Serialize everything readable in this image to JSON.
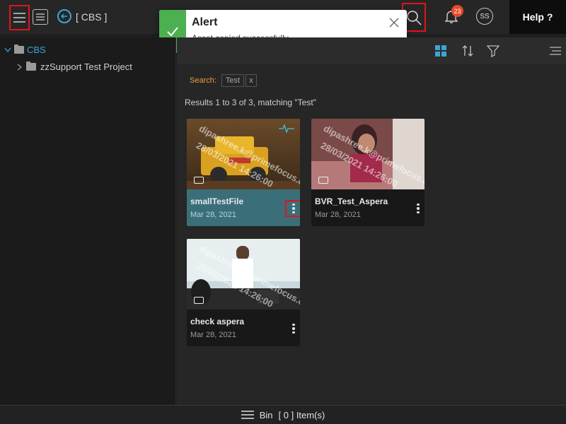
{
  "header": {
    "breadcrumb": "[ CBS ]",
    "notification_count": "23",
    "avatar_initials": "SS",
    "help_label": "Help ?"
  },
  "sidebar": {
    "root_label": "CBS",
    "child_label": "zzSupport Test Project"
  },
  "search": {
    "label": "Search:",
    "term": "Test",
    "clear": "x"
  },
  "results_text": "Results 1 to 3 of 3, matching \"Test\"",
  "assets": [
    {
      "title": "smallTestFile",
      "date": "Mar 28, 2021",
      "selected": true
    },
    {
      "title": "BVR_Test_Aspera",
      "date": "Mar 28, 2021",
      "selected": false
    },
    {
      "title": "check aspera",
      "date": "Mar 28, 2021",
      "selected": false
    }
  ],
  "watermark": {
    "line1": "dipashree.k@primefocus.c",
    "line2": "28/03/2021 14:26:00"
  },
  "alert": {
    "title": "Alert",
    "message": "Asset copied successfully"
  },
  "bin": {
    "label": "Bin",
    "count": "[ 0 ] Item(s)"
  },
  "colors": {
    "accent": "#3ba6d6",
    "success": "#4caf50",
    "selected_card": "#3a6f7a",
    "highlight": "#e0141c",
    "badge": "#e8492a"
  }
}
